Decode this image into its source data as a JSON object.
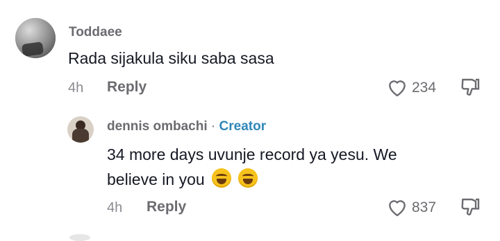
{
  "comment": {
    "username": "Toddaee",
    "text": "Rada sijakula siku saba sasa",
    "time": "4h",
    "reply_label": "Reply",
    "like_count": "234"
  },
  "reply": {
    "username": "dennis ombachi",
    "separator": "·",
    "badge": "Creator",
    "text_line1": "34 more days uvunje record ya yesu. We",
    "text_line2": "believe in you",
    "emoji": "face-with-tears-of-joy",
    "time": "4h",
    "reply_label": "Reply",
    "like_count": "837"
  },
  "colors": {
    "text": "#161823",
    "muted": "#6b6b70",
    "creator": "#2f87b8"
  }
}
